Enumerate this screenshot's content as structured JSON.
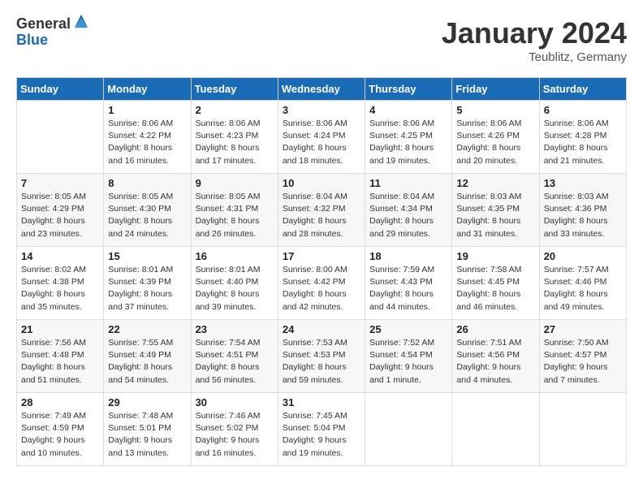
{
  "logo": {
    "text_general": "General",
    "text_blue": "Blue"
  },
  "title": "January 2024",
  "location": "Teublitz, Germany",
  "days_of_week": [
    "Sunday",
    "Monday",
    "Tuesday",
    "Wednesday",
    "Thursday",
    "Friday",
    "Saturday"
  ],
  "weeks": [
    [
      {
        "day": "",
        "sunrise": "",
        "sunset": "",
        "daylight": ""
      },
      {
        "day": "1",
        "sunrise": "Sunrise: 8:06 AM",
        "sunset": "Sunset: 4:22 PM",
        "daylight": "Daylight: 8 hours and 16 minutes."
      },
      {
        "day": "2",
        "sunrise": "Sunrise: 8:06 AM",
        "sunset": "Sunset: 4:23 PM",
        "daylight": "Daylight: 8 hours and 17 minutes."
      },
      {
        "day": "3",
        "sunrise": "Sunrise: 8:06 AM",
        "sunset": "Sunset: 4:24 PM",
        "daylight": "Daylight: 8 hours and 18 minutes."
      },
      {
        "day": "4",
        "sunrise": "Sunrise: 8:06 AM",
        "sunset": "Sunset: 4:25 PM",
        "daylight": "Daylight: 8 hours and 19 minutes."
      },
      {
        "day": "5",
        "sunrise": "Sunrise: 8:06 AM",
        "sunset": "Sunset: 4:26 PM",
        "daylight": "Daylight: 8 hours and 20 minutes."
      },
      {
        "day": "6",
        "sunrise": "Sunrise: 8:06 AM",
        "sunset": "Sunset: 4:28 PM",
        "daylight": "Daylight: 8 hours and 21 minutes."
      }
    ],
    [
      {
        "day": "7",
        "sunrise": "Sunrise: 8:05 AM",
        "sunset": "Sunset: 4:29 PM",
        "daylight": "Daylight: 8 hours and 23 minutes."
      },
      {
        "day": "8",
        "sunrise": "Sunrise: 8:05 AM",
        "sunset": "Sunset: 4:30 PM",
        "daylight": "Daylight: 8 hours and 24 minutes."
      },
      {
        "day": "9",
        "sunrise": "Sunrise: 8:05 AM",
        "sunset": "Sunset: 4:31 PM",
        "daylight": "Daylight: 8 hours and 26 minutes."
      },
      {
        "day": "10",
        "sunrise": "Sunrise: 8:04 AM",
        "sunset": "Sunset: 4:32 PM",
        "daylight": "Daylight: 8 hours and 28 minutes."
      },
      {
        "day": "11",
        "sunrise": "Sunrise: 8:04 AM",
        "sunset": "Sunset: 4:34 PM",
        "daylight": "Daylight: 8 hours and 29 minutes."
      },
      {
        "day": "12",
        "sunrise": "Sunrise: 8:03 AM",
        "sunset": "Sunset: 4:35 PM",
        "daylight": "Daylight: 8 hours and 31 minutes."
      },
      {
        "day": "13",
        "sunrise": "Sunrise: 8:03 AM",
        "sunset": "Sunset: 4:36 PM",
        "daylight": "Daylight: 8 hours and 33 minutes."
      }
    ],
    [
      {
        "day": "14",
        "sunrise": "Sunrise: 8:02 AM",
        "sunset": "Sunset: 4:38 PM",
        "daylight": "Daylight: 8 hours and 35 minutes."
      },
      {
        "day": "15",
        "sunrise": "Sunrise: 8:01 AM",
        "sunset": "Sunset: 4:39 PM",
        "daylight": "Daylight: 8 hours and 37 minutes."
      },
      {
        "day": "16",
        "sunrise": "Sunrise: 8:01 AM",
        "sunset": "Sunset: 4:40 PM",
        "daylight": "Daylight: 8 hours and 39 minutes."
      },
      {
        "day": "17",
        "sunrise": "Sunrise: 8:00 AM",
        "sunset": "Sunset: 4:42 PM",
        "daylight": "Daylight: 8 hours and 42 minutes."
      },
      {
        "day": "18",
        "sunrise": "Sunrise: 7:59 AM",
        "sunset": "Sunset: 4:43 PM",
        "daylight": "Daylight: 8 hours and 44 minutes."
      },
      {
        "day": "19",
        "sunrise": "Sunrise: 7:58 AM",
        "sunset": "Sunset: 4:45 PM",
        "daylight": "Daylight: 8 hours and 46 minutes."
      },
      {
        "day": "20",
        "sunrise": "Sunrise: 7:57 AM",
        "sunset": "Sunset: 4:46 PM",
        "daylight": "Daylight: 8 hours and 49 minutes."
      }
    ],
    [
      {
        "day": "21",
        "sunrise": "Sunrise: 7:56 AM",
        "sunset": "Sunset: 4:48 PM",
        "daylight": "Daylight: 8 hours and 51 minutes."
      },
      {
        "day": "22",
        "sunrise": "Sunrise: 7:55 AM",
        "sunset": "Sunset: 4:49 PM",
        "daylight": "Daylight: 8 hours and 54 minutes."
      },
      {
        "day": "23",
        "sunrise": "Sunrise: 7:54 AM",
        "sunset": "Sunset: 4:51 PM",
        "daylight": "Daylight: 8 hours and 56 minutes."
      },
      {
        "day": "24",
        "sunrise": "Sunrise: 7:53 AM",
        "sunset": "Sunset: 4:53 PM",
        "daylight": "Daylight: 8 hours and 59 minutes."
      },
      {
        "day": "25",
        "sunrise": "Sunrise: 7:52 AM",
        "sunset": "Sunset: 4:54 PM",
        "daylight": "Daylight: 9 hours and 1 minute."
      },
      {
        "day": "26",
        "sunrise": "Sunrise: 7:51 AM",
        "sunset": "Sunset: 4:56 PM",
        "daylight": "Daylight: 9 hours and 4 minutes."
      },
      {
        "day": "27",
        "sunrise": "Sunrise: 7:50 AM",
        "sunset": "Sunset: 4:57 PM",
        "daylight": "Daylight: 9 hours and 7 minutes."
      }
    ],
    [
      {
        "day": "28",
        "sunrise": "Sunrise: 7:49 AM",
        "sunset": "Sunset: 4:59 PM",
        "daylight": "Daylight: 9 hours and 10 minutes."
      },
      {
        "day": "29",
        "sunrise": "Sunrise: 7:48 AM",
        "sunset": "Sunset: 5:01 PM",
        "daylight": "Daylight: 9 hours and 13 minutes."
      },
      {
        "day": "30",
        "sunrise": "Sunrise: 7:46 AM",
        "sunset": "Sunset: 5:02 PM",
        "daylight": "Daylight: 9 hours and 16 minutes."
      },
      {
        "day": "31",
        "sunrise": "Sunrise: 7:45 AM",
        "sunset": "Sunset: 5:04 PM",
        "daylight": "Daylight: 9 hours and 19 minutes."
      },
      {
        "day": "",
        "sunrise": "",
        "sunset": "",
        "daylight": ""
      },
      {
        "day": "",
        "sunrise": "",
        "sunset": "",
        "daylight": ""
      },
      {
        "day": "",
        "sunrise": "",
        "sunset": "",
        "daylight": ""
      }
    ]
  ]
}
